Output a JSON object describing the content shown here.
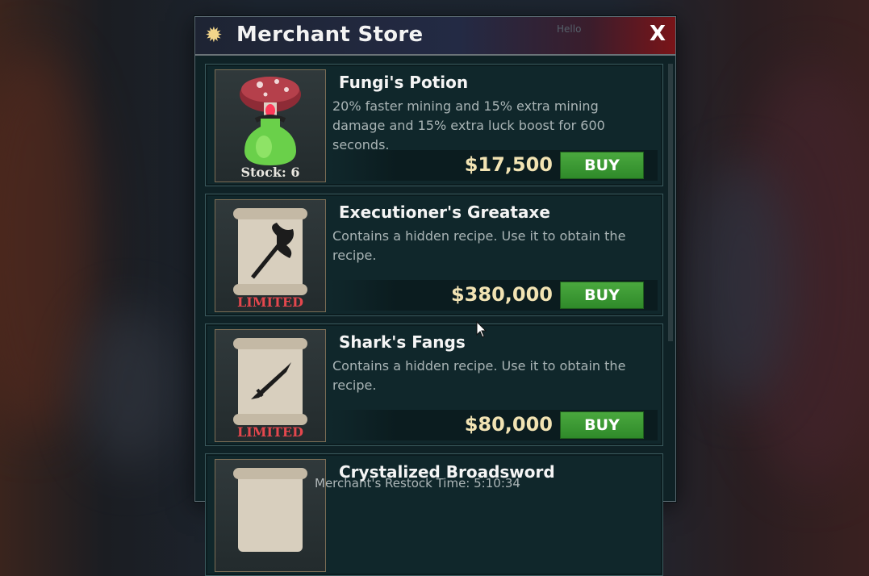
{
  "store": {
    "title": "Merchant Store",
    "close_label": "X",
    "ghost_help": "Hello",
    "buy_label": "BUY",
    "footer_text": "Merchant's Restock Time: 5:10:34"
  },
  "items": [
    {
      "name": "Fungi's Potion",
      "description": "20% faster mining and 15% extra mining damage and 15% extra luck boost for 600 seconds.",
      "price": "$17,500",
      "badge": "Stock: 6",
      "icon": "potion-icon"
    },
    {
      "name": "Executioner's Greataxe",
      "description": "Contains a hidden recipe. Use it to obtain the recipe.",
      "price": "$380,000",
      "badge": "LIMITED",
      "icon": "scroll-axe-icon"
    },
    {
      "name": "Shark's Fangs",
      "description": "Contains a hidden recipe. Use it to obtain the recipe.",
      "price": "$80,000",
      "badge": "LIMITED",
      "icon": "scroll-dagger-icon"
    },
    {
      "name": "Crystalized Broadsword",
      "icon": "scroll-icon"
    }
  ],
  "colors": {
    "buy_green": "#3a9a33",
    "price_gold": "#f2e3b3",
    "limited_red": "#e4474d",
    "close_red": "#7a1418"
  }
}
